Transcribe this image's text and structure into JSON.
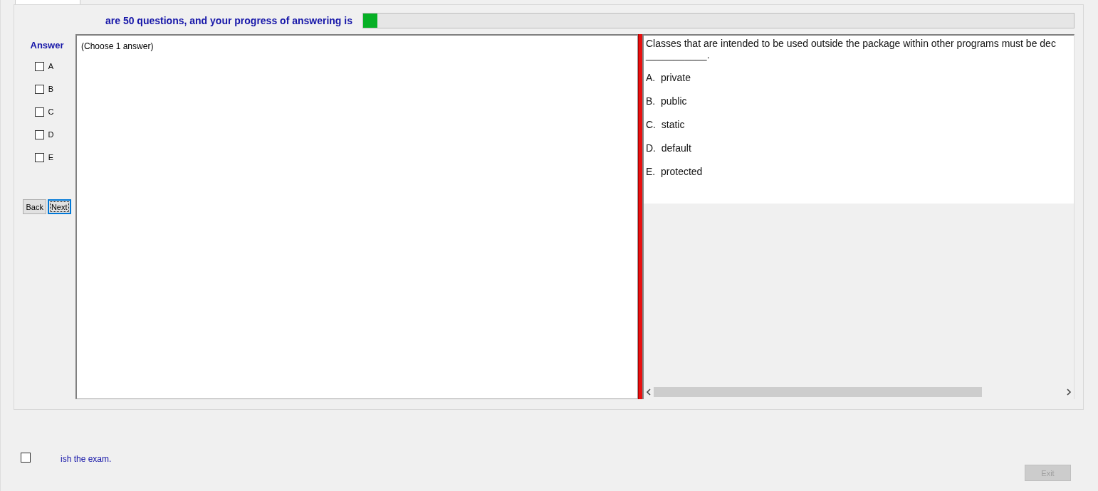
{
  "header": {
    "text": "are 50 questions, and your progress of answering is",
    "progress": {
      "level": 0.02
    }
  },
  "answer_panel": {
    "title": "Answer",
    "options": [
      {
        "label": "A",
        "checked": false
      },
      {
        "label": "B",
        "checked": false
      },
      {
        "label": "C",
        "checked": false
      },
      {
        "label": "D",
        "checked": false
      },
      {
        "label": "E",
        "checked": false
      }
    ],
    "buttons": [
      {
        "label": "Back",
        "focused": false
      },
      {
        "label": "Next",
        "focused": true
      }
    ]
  },
  "instruction": "(Choose 1 answer)",
  "question": {
    "text": "Classes that are intended to be used outside the package within other programs must be dec",
    "blank": "___________.",
    "choices": [
      {
        "letter": "A.",
        "text": "private"
      },
      {
        "letter": "B.",
        "text": "public"
      },
      {
        "letter": "C.",
        "text": "static"
      },
      {
        "letter": "D.",
        "text": "default"
      },
      {
        "letter": "E.",
        "text": "protected"
      }
    ]
  },
  "finish": {
    "checked": false,
    "label": "ish the exam."
  },
  "exit_button": {
    "label": "Exit",
    "disabled": true
  }
}
